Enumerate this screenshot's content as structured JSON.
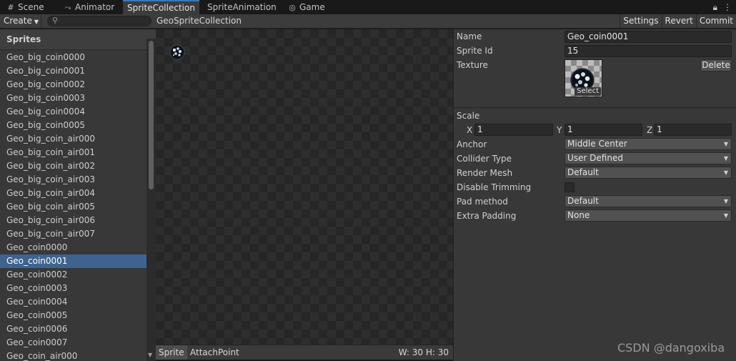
{
  "tabs": [
    {
      "label": "Scene",
      "icon": "grid-icon"
    },
    {
      "label": "Animator",
      "icon": "animator-icon"
    },
    {
      "label": "SpriteCollection",
      "icon": ""
    },
    {
      "label": "SpriteAnimation",
      "icon": ""
    },
    {
      "label": "Game",
      "icon": "gamepad-icon"
    }
  ],
  "toolbar": {
    "create_label": "Create",
    "search_value": "",
    "collection_name": "GeoSpriteCollection",
    "settings_label": "Settings",
    "revert_label": "Revert",
    "commit_label": "Commit"
  },
  "sidebar": {
    "header": "Sprites",
    "items": [
      "Geo_big_coin0000",
      "Geo_big_coin0001",
      "Geo_big_coin0002",
      "Geo_big_coin0003",
      "Geo_big_coin0004",
      "Geo_big_coin0005",
      "Geo_big_coin_air000",
      "Geo_big_coin_air001",
      "Geo_big_coin_air002",
      "Geo_big_coin_air003",
      "Geo_big_coin_air004",
      "Geo_big_coin_air005",
      "Geo_big_coin_air006",
      "Geo_big_coin_air007",
      "Geo_coin0000",
      "Geo_coin0001",
      "Geo_coin0002",
      "Geo_coin0003",
      "Geo_coin0004",
      "Geo_coin0005",
      "Geo_coin0006",
      "Geo_coin0007",
      "Geo_coin_air000"
    ],
    "selected_index": 15
  },
  "preview": {
    "tab_sprite": "Sprite",
    "tab_attach": "AttachPoint",
    "dims": "W: 30 H: 30"
  },
  "inspector": {
    "name_label": "Name",
    "name_value": "Geo_coin0001",
    "sprite_id_label": "Sprite Id",
    "sprite_id_value": "15",
    "texture_label": "Texture",
    "texture_select": "Select",
    "delete_label": "Delete",
    "scale_label": "Scale",
    "scale_x_label": "X",
    "scale_x": "1",
    "scale_y_label": "Y",
    "scale_y": "1",
    "scale_z_label": "Z",
    "scale_z": "1",
    "anchor_label": "Anchor",
    "anchor_value": "Middle Center",
    "collider_label": "Collider Type",
    "collider_value": "User Defined",
    "render_mesh_label": "Render Mesh",
    "render_mesh_value": "Default",
    "disable_trim_label": "Disable Trimming",
    "disable_trim_checked": false,
    "pad_method_label": "Pad method",
    "pad_method_value": "Default",
    "extra_padding_label": "Extra Padding",
    "extra_padding_value": "None"
  },
  "watermark": "CSDN @dangoxiba",
  "colors": {
    "selection": "#3f638f",
    "active_tab_accent": "#3a79bb",
    "panel_bg": "#383838"
  }
}
